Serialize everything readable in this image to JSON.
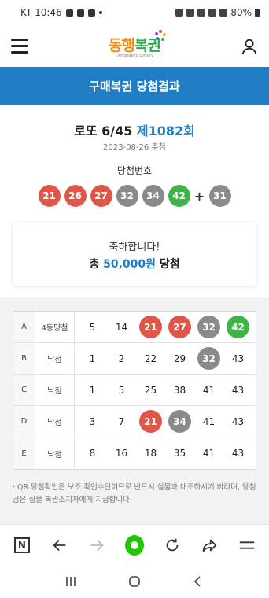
{
  "status_bar": {
    "carrier_time": "KT 10:46",
    "battery": "80%"
  },
  "header": {
    "logo_text_main": "동행",
    "logo_text_accent": "복권",
    "logo_sub": "Donghaeng Lottery"
  },
  "title_bar": {
    "title": "구매복권 당첨결과"
  },
  "draw": {
    "game": "로또 6/45",
    "round": "제1082회",
    "date": "2023-08-26 추첨",
    "winning_label": "당첨번호",
    "numbers": [
      "21",
      "26",
      "27",
      "32",
      "34",
      "42"
    ],
    "plus": "+",
    "bonus": "31"
  },
  "congrats": {
    "message": "축하합니다!",
    "prize_prefix": "총",
    "prize_amount": "50,000원",
    "prize_suffix": "당첨"
  },
  "results": [
    {
      "letter": "A",
      "status": "4등당첨",
      "numbers": [
        "5",
        "14",
        "21",
        "27",
        "32",
        "42"
      ]
    },
    {
      "letter": "B",
      "status": "낙첨",
      "numbers": [
        "1",
        "2",
        "22",
        "29",
        "32",
        "43"
      ]
    },
    {
      "letter": "C",
      "status": "낙첨",
      "numbers": [
        "1",
        "5",
        "25",
        "38",
        "41",
        "43"
      ]
    },
    {
      "letter": "D",
      "status": "낙첨",
      "numbers": [
        "3",
        "7",
        "21",
        "34",
        "41",
        "43"
      ]
    },
    {
      "letter": "E",
      "status": "낙첨",
      "numbers": [
        "8",
        "16",
        "18",
        "35",
        "41",
        "43"
      ]
    }
  ],
  "notice": "· QR 당첨확인은 보조 확인수단이므로 반드시 실물과 대조하시기 바라며, 당첨금은 실물 복권소지자에게 지급합니다.",
  "browser_bar": {
    "n_label": "N",
    "icons": [
      "n-icon",
      "back-arrow-icon",
      "forward-arrow-icon",
      "home-icon",
      "refresh-icon",
      "share-icon",
      "menu-icon"
    ]
  },
  "colors": {
    "brand_blue": "#1f7dc4",
    "ball_red": "#e0574a",
    "ball_gray": "#8a8a8a",
    "ball_green": "#3db34a"
  }
}
